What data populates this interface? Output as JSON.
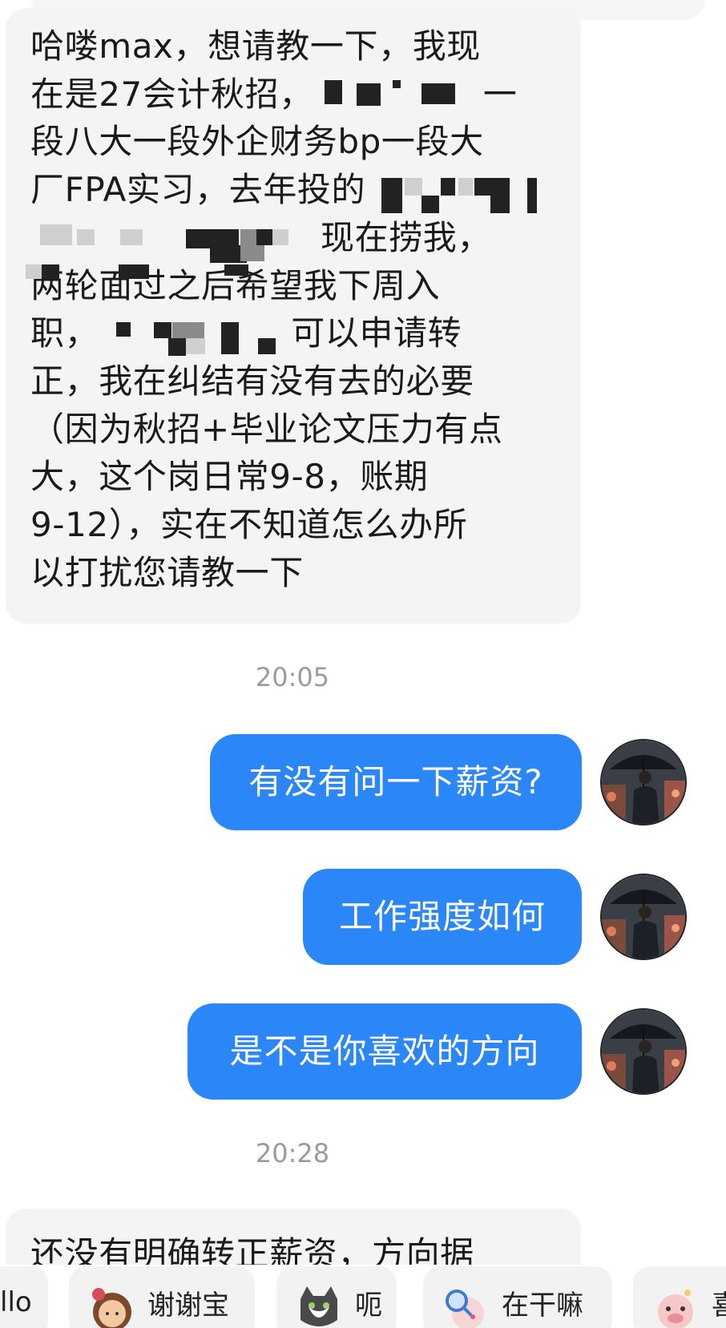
{
  "messages": {
    "incoming_1": {
      "lines": [
        "哈喽max，想请教一下，我现",
        "在是27会计秋招，",
        "一",
        "段八大一段外企财务bp一段大",
        "厂FPA实习，去年投的",
        "现在捞我，",
        "两轮面过之后希望我下周入",
        "职，",
        "可以申请转",
        "正，我在纠结有没有去的必要",
        "（因为秋招+毕业论文压力有点",
        "大，这个岗日常9-8，账期",
        "9-12），实在不知道怎么办所",
        "以打扰您请教一下"
      ]
    },
    "time_1": "20:05",
    "outgoing": [
      {
        "text": "有没有问一下薪资?"
      },
      {
        "text": "工作强度如何"
      },
      {
        "text": "是不是你喜欢的方向"
      }
    ],
    "time_2": "20:28",
    "incoming_2": {
      "text": "还没有明确转正薪资，方向据"
    }
  },
  "quick_replies": [
    {
      "label": "llo",
      "icon": "hello-sticker-icon"
    },
    {
      "label": "谢谢宝",
      "icon": "girl-rose-sticker-icon"
    },
    {
      "label": "呃",
      "icon": "cat-sticker-icon"
    },
    {
      "label": "在干嘛",
      "icon": "magnifier-pig-sticker-icon"
    },
    {
      "label": "喜",
      "icon": "pig-sticker-icon"
    }
  ],
  "colors": {
    "outgoing_bubble": "#2b86f7",
    "incoming_bubble": "#f4f4f4",
    "timestamp": "#9b9b9b"
  }
}
